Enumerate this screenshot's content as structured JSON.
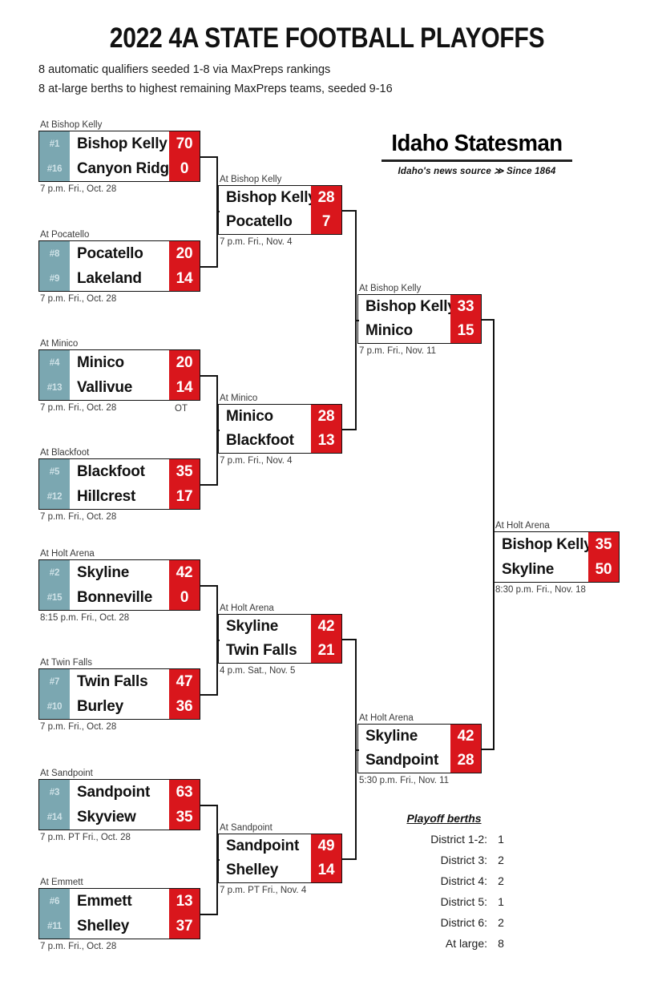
{
  "header": {
    "title": "2022 4A STATE FOOTBALL PLAYOFFS",
    "subtitle1": "8 automatic qualifiers seeded 1-8 via MaxPreps rankings",
    "subtitle2": "8 at-large berths to highest remaining MaxPreps teams, seeded 9-16"
  },
  "masthead": {
    "name": "Idaho Statesman",
    "tagline": "Idaho's news source ≫ Since 1864"
  },
  "colors": {
    "seed_bg": "#7ba7b1",
    "score_bg": "#d9161c",
    "border": "#111111"
  },
  "round1": [
    {
      "venue": "At Bishop Kelly",
      "time": "7 p.m. Fri., Oct. 28",
      "note": "",
      "teams": [
        {
          "seed": "#1",
          "name": "Bishop Kelly",
          "score": "70"
        },
        {
          "seed": "#16",
          "name": "Canyon Ridge",
          "score": "0"
        }
      ]
    },
    {
      "venue": "At Pocatello",
      "time": "7 p.m. Fri., Oct. 28",
      "note": "",
      "teams": [
        {
          "seed": "#8",
          "name": "Pocatello",
          "score": "20"
        },
        {
          "seed": "#9",
          "name": "Lakeland",
          "score": "14"
        }
      ]
    },
    {
      "venue": "At Minico",
      "time": "7 p.m. Fri., Oct. 28",
      "note": "OT",
      "teams": [
        {
          "seed": "#4",
          "name": "Minico",
          "score": "20"
        },
        {
          "seed": "#13",
          "name": "Vallivue",
          "score": "14"
        }
      ]
    },
    {
      "venue": "At Blackfoot",
      "time": "7 p.m. Fri., Oct. 28",
      "note": "",
      "teams": [
        {
          "seed": "#5",
          "name": "Blackfoot",
          "score": "35"
        },
        {
          "seed": "#12",
          "name": "Hillcrest",
          "score": "17"
        }
      ]
    },
    {
      "venue": "At Holt Arena",
      "time": "8:15 p.m. Fri., Oct. 28",
      "note": "",
      "teams": [
        {
          "seed": "#2",
          "name": "Skyline",
          "score": "42"
        },
        {
          "seed": "#15",
          "name": "Bonneville",
          "score": "0"
        }
      ]
    },
    {
      "venue": "At Twin Falls",
      "time": "7 p.m. Fri., Oct. 28",
      "note": "",
      "teams": [
        {
          "seed": "#7",
          "name": "Twin Falls",
          "score": "47"
        },
        {
          "seed": "#10",
          "name": "Burley",
          "score": "36"
        }
      ]
    },
    {
      "venue": "At Sandpoint",
      "time": "7 p.m. PT Fri., Oct. 28",
      "note": "",
      "teams": [
        {
          "seed": "#3",
          "name": "Sandpoint",
          "score": "63"
        },
        {
          "seed": "#14",
          "name": "Skyview",
          "score": "35"
        }
      ]
    },
    {
      "venue": "At Emmett",
      "time": "7 p.m. Fri., Oct. 28",
      "note": "",
      "teams": [
        {
          "seed": "#6",
          "name": "Emmett",
          "score": "13"
        },
        {
          "seed": "#11",
          "name": "Shelley",
          "score": "37"
        }
      ]
    }
  ],
  "round2": [
    {
      "venue": "At Bishop Kelly",
      "time": "7 p.m. Fri., Nov. 4",
      "teams": [
        {
          "name": "Bishop Kelly",
          "score": "28"
        },
        {
          "name": "Pocatello",
          "score": "7"
        }
      ]
    },
    {
      "venue": "At Minico",
      "time": "7 p.m. Fri., Nov. 4",
      "teams": [
        {
          "name": "Minico",
          "score": "28"
        },
        {
          "name": "Blackfoot",
          "score": "13"
        }
      ]
    },
    {
      "venue": "At Holt Arena",
      "time": "4 p.m. Sat., Nov. 5",
      "teams": [
        {
          "name": "Skyline",
          "score": "42"
        },
        {
          "name": "Twin Falls",
          "score": "21"
        }
      ]
    },
    {
      "venue": "At Sandpoint",
      "time": "7 p.m. PT Fri., Nov. 4",
      "teams": [
        {
          "name": "Sandpoint",
          "score": "49"
        },
        {
          "name": "Shelley",
          "score": "14"
        }
      ]
    }
  ],
  "round3": [
    {
      "venue": "At Bishop Kelly",
      "time": "7 p.m. Fri., Nov. 11",
      "teams": [
        {
          "name": "Bishop Kelly",
          "score": "33"
        },
        {
          "name": "Minico",
          "score": "15"
        }
      ]
    },
    {
      "venue": "At Holt Arena",
      "time": "5:30 p.m. Fri., Nov. 11",
      "teams": [
        {
          "name": "Skyline",
          "score": "42"
        },
        {
          "name": "Sandpoint",
          "score": "28"
        }
      ]
    }
  ],
  "final": {
    "venue": "At Holt Arena",
    "time": "8:30 p.m. Fri., Nov. 18",
    "teams": [
      {
        "name": "Bishop Kelly",
        "score": "35"
      },
      {
        "name": "Skyline",
        "score": "50"
      }
    ]
  },
  "berths": {
    "title": "Playoff berths",
    "rows": [
      {
        "label": "District 1-2:",
        "value": "1"
      },
      {
        "label": "District 3:",
        "value": "2"
      },
      {
        "label": "District 4:",
        "value": "2"
      },
      {
        "label": "District 5:",
        "value": "1"
      },
      {
        "label": "District 6:",
        "value": "2"
      },
      {
        "label": "At large:",
        "value": "8"
      }
    ]
  }
}
